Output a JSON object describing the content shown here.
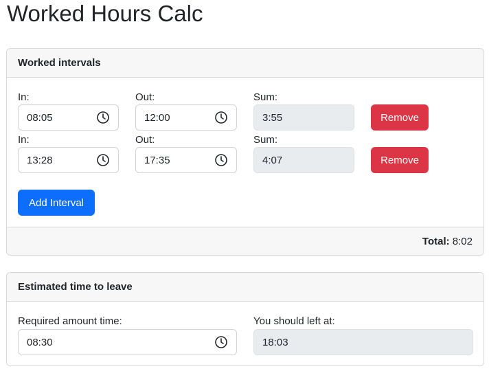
{
  "page_title": "Worked Hours Calc",
  "intervals_card": {
    "header": "Worked intervals",
    "in_label": "In:",
    "out_label": "Out:",
    "sum_label": "Sum:",
    "remove_label": "Remove",
    "rows": [
      {
        "in": "08:05",
        "out": "12:00",
        "sum": "3:55"
      },
      {
        "in": "13:28",
        "out": "17:35",
        "sum": "4:07"
      }
    ],
    "add_label": "Add Interval",
    "total_label": "Total:",
    "total_value": "8:02"
  },
  "estimate_card": {
    "header": "Estimated time to leave",
    "required_label": "Required amount time:",
    "required_value": "08:30",
    "leave_label": "You should left at:",
    "leave_value": "18:03"
  },
  "colors": {
    "danger": "#dc3545",
    "primary": "#0d6efd",
    "readonly_bg": "#e9ecef"
  },
  "icons": [
    "clock-icon"
  ]
}
